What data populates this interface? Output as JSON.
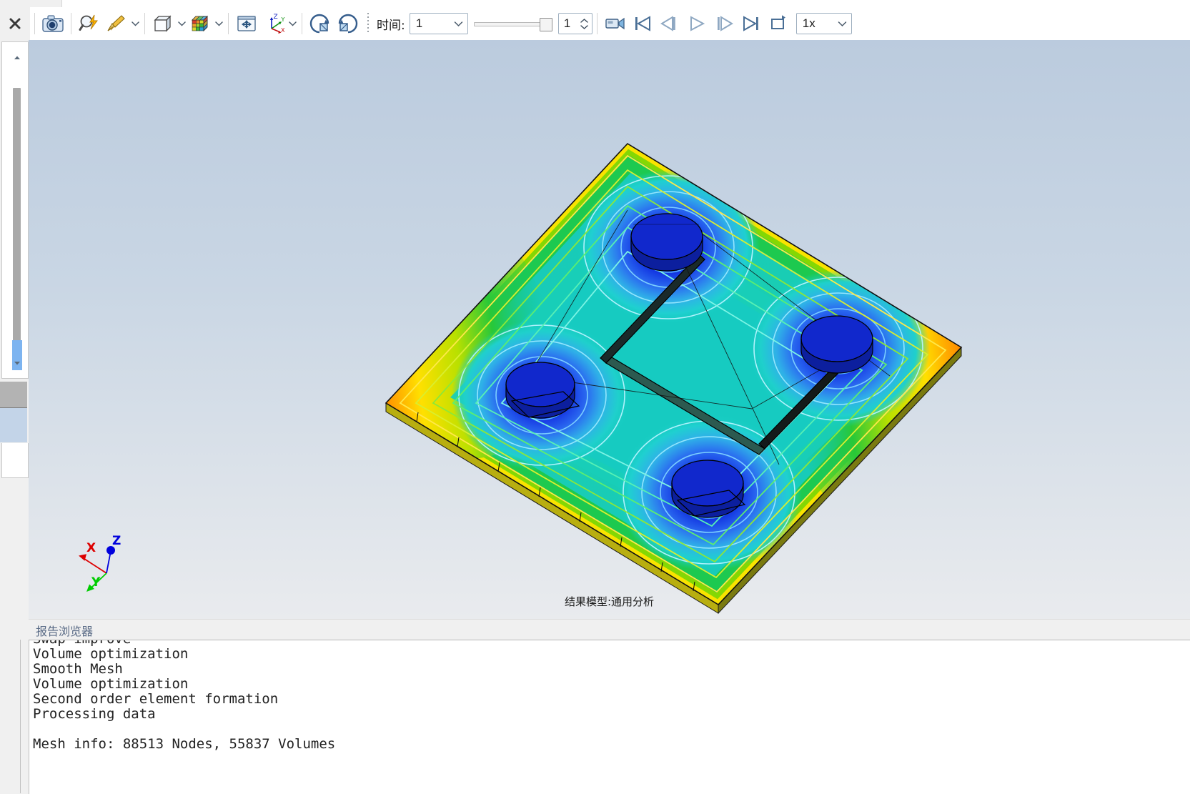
{
  "window": {
    "close_label": "✕"
  },
  "toolbar": {
    "buttons": [
      {
        "name": "snapshot",
        "label": "Snapshot",
        "icon": "camera-icon"
      },
      {
        "name": "zoom-lightning",
        "label": "Quick Zoom",
        "icon": "magnifier-lightning-icon"
      },
      {
        "name": "clear",
        "label": "Clear",
        "icon": "broom-icon"
      },
      {
        "name": "geometry",
        "label": "Geometry",
        "icon": "cube-icon"
      },
      {
        "name": "contour",
        "label": "Contour Plot",
        "icon": "colored-cube-icon"
      },
      {
        "name": "pan",
        "label": "Pan / Move",
        "icon": "move-arrows-icon"
      },
      {
        "name": "orientation",
        "label": "Orientation",
        "icon": "axis-triad-icon"
      },
      {
        "name": "rotate-cw",
        "label": "Rotate Clockwise",
        "icon": "rotate-cw-icon"
      },
      {
        "name": "rotate-ccw",
        "label": "Rotate Counter-Clockwise",
        "icon": "rotate-ccw-icon"
      }
    ],
    "time_label": "时间:",
    "time_value": "1",
    "frame_value": "1",
    "playback": [
      {
        "name": "record",
        "label": "Record Animation",
        "icon": "video-camera-icon"
      },
      {
        "name": "first",
        "label": "First Frame",
        "icon": "skip-start-icon"
      },
      {
        "name": "prev",
        "label": "Previous Frame",
        "icon": "step-back-icon"
      },
      {
        "name": "play",
        "label": "Play",
        "icon": "play-icon"
      },
      {
        "name": "next",
        "label": "Next Frame",
        "icon": "step-forward-icon"
      },
      {
        "name": "last",
        "label": "Last Frame",
        "icon": "skip-end-icon"
      },
      {
        "name": "loop",
        "label": "Loop",
        "icon": "loop-icon"
      }
    ],
    "speed_value": "1x"
  },
  "viewport": {
    "caption": "结果模型:通用分析",
    "axis": {
      "x_label": "X",
      "y_label": "Y",
      "z_label": "Z",
      "x_color": "#dd0000",
      "y_color": "#00cc00",
      "z_color": "#0000dd"
    },
    "background_top": "#bbcbde",
    "background_bottom": "#e9ebee"
  },
  "report": {
    "title": "报告浏览器"
  },
  "log": {
    "lines": [
      "Swap improve",
      "Volume optimization",
      "Smooth Mesh",
      "Volume optimization",
      "Second order element formation",
      "Processing data",
      "",
      "Mesh info: 88513 Nodes, 55837 Volumes"
    ]
  },
  "chart_data": {
    "type": "heatmap",
    "title": "结果模型:通用分析",
    "description": "3D finite-element contour (rainbow colormap) on a rotated rectangular plate with four circular bosses and an H-shaped raised channel.",
    "colormap": [
      "#0000cc",
      "#0066ff",
      "#00ccff",
      "#00e5c8",
      "#00cc44",
      "#88dd00",
      "#ffee00",
      "#ff7700",
      "#cc0000"
    ],
    "hot_spots": [
      "left corner",
      "right corner"
    ],
    "cold_spots": [
      "boss-1 top",
      "boss-2 right",
      "boss-3 left",
      "boss-4 bottom"
    ],
    "contour_lines": true
  }
}
